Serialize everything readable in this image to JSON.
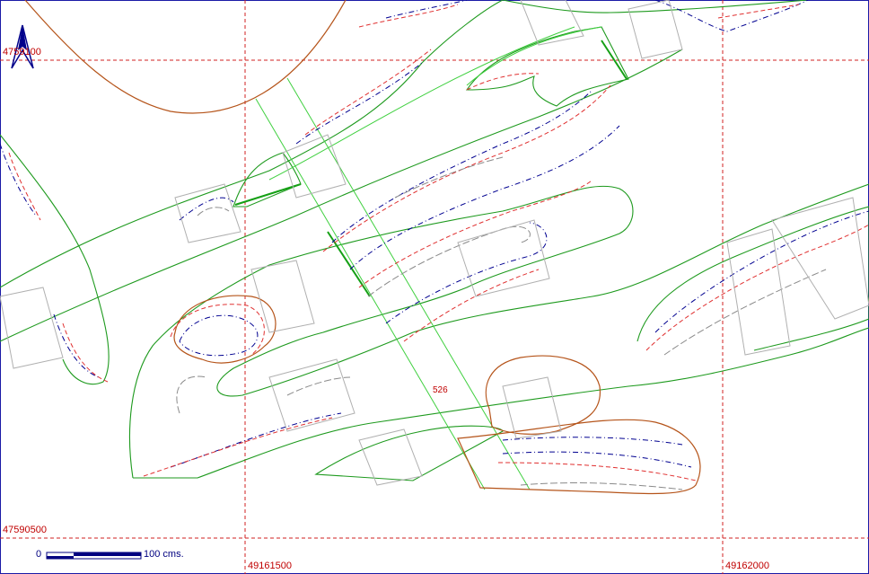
{
  "map": {
    "north_arrow_icon": "north-arrow-icon",
    "grid_labels": {
      "northing_top": "4759100",
      "northing_bottom": "47590500",
      "easting_left": "49161500",
      "easting_right": "49162000"
    },
    "parcel_label": "526",
    "scale_bar": {
      "start_label": "0",
      "end_label": "100 cms."
    },
    "colors": {
      "frame": "#1a1aa6",
      "grid": "#d02020",
      "boundary_green": "#1e9a1e",
      "light_green": "#40d040",
      "brown": "#b5541a",
      "contour_blue": "#000090",
      "contour_red": "#e03030",
      "contour_gray": "#8a8a8a"
    }
  }
}
